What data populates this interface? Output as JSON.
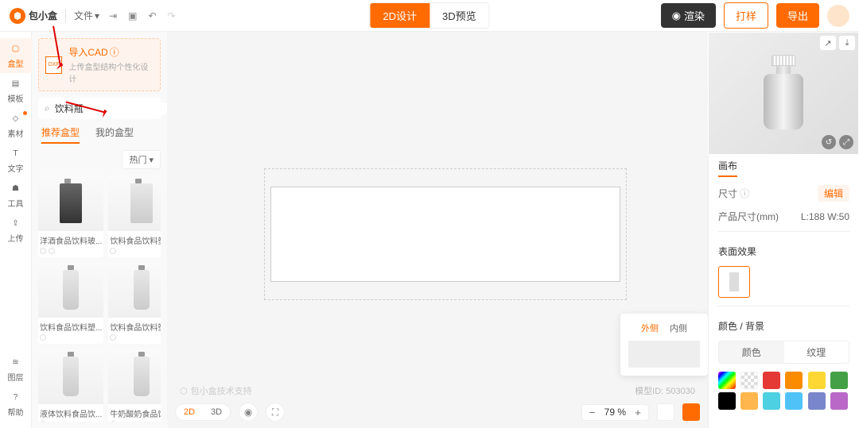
{
  "app_name": "包小盒",
  "file_menu": "文件",
  "view": {
    "d2": "2D设计",
    "d3": "3D预览"
  },
  "top_actions": {
    "render": "渲染",
    "sample": "打样",
    "export": "导出"
  },
  "sidebar": {
    "items": [
      {
        "label": "盒型",
        "icon": "box"
      },
      {
        "label": "模板",
        "icon": "grid"
      },
      {
        "label": "素材",
        "icon": "shape"
      },
      {
        "label": "文字",
        "icon": "text"
      },
      {
        "label": "工具",
        "icon": "tool"
      },
      {
        "label": "上传",
        "icon": "upload"
      }
    ],
    "layers": "图层",
    "help": "帮助"
  },
  "cad": {
    "title": "导入CAD",
    "sub": "上传盒型结构个性化设计"
  },
  "search": {
    "placeholder": "",
    "value": "饮料瓶"
  },
  "panel_tabs": {
    "rec": "推荐盒型",
    "my": "我的盒型"
  },
  "sort": "热门",
  "thumbs": [
    {
      "label": "洋酒食品饮料玻..."
    },
    {
      "label": "饮料食品饮料塑..."
    },
    {
      "label": "饮料食品饮料塑..."
    },
    {
      "label": "饮料食品饮料塑..."
    },
    {
      "label": "液体饮料食品饮..."
    },
    {
      "label": "牛奶酸奶食品饮..."
    }
  ],
  "watermark": "包小盒技术支持",
  "model_id_label": "模型ID:",
  "model_id": "503030",
  "canvas_bottom": {
    "d2": "2D",
    "d3": "3D"
  },
  "zoom": "79 %",
  "popup": {
    "outside": "外侧",
    "inside": "内侧"
  },
  "right": {
    "tab": "画布",
    "size_label": "尺寸",
    "edit": "编辑",
    "prod_size_label": "产品尺寸(mm)",
    "prod_size_value": "L:188  W:50",
    "surface": "表面效果",
    "color_bg": "颜色 / 背景",
    "seg_color": "颜色",
    "seg_texture": "纹理",
    "swatches": [
      "rainbow",
      "trans",
      "#E53935",
      "#FB8C00",
      "#FDD835",
      "#43A047",
      "#000000",
      "#FFB74D",
      "#4DD0E1",
      "#4FC3F7",
      "#7986CB",
      "#BA68C8"
    ]
  }
}
